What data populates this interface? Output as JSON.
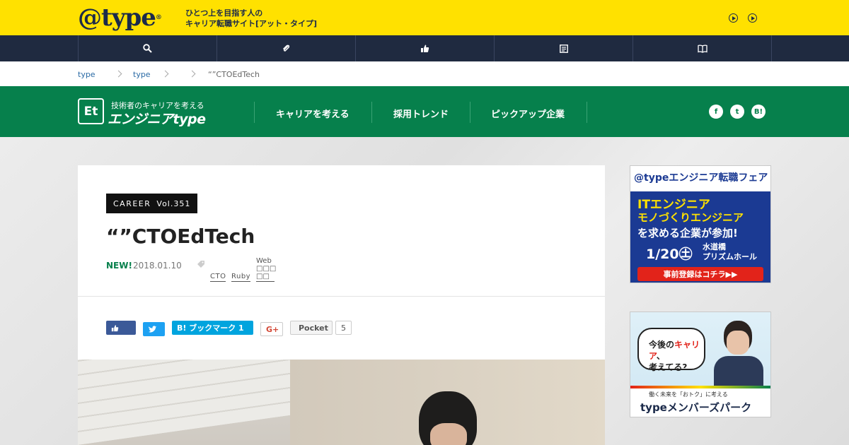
{
  "site": {
    "logo": "@type",
    "tagline_1": "ひとつ上を目指す人の",
    "tagline_2": "キャリア転職サイト[アット・タイプ]"
  },
  "darknav": {
    "items": [
      {
        "icon": "search-icon"
      },
      {
        "icon": "paperclip-icon"
      },
      {
        "icon": "thumbs-up-icon"
      },
      {
        "icon": "list-icon"
      },
      {
        "icon": "book-icon"
      }
    ]
  },
  "breadcrumb": {
    "items": [
      "type",
      "type",
      "",
      "“”CTOEdTech"
    ]
  },
  "header": {
    "brand_sub": "技術者のキャリアを考える",
    "brand_title": "エンジニアtype",
    "brand_mark": "Et",
    "nav": [
      "キャリアを考える",
      "採用トレンド",
      "ピックアップ企業"
    ],
    "social": [
      {
        "icon": "facebook-icon",
        "glyph": "f"
      },
      {
        "icon": "twitter-icon",
        "glyph": "t"
      },
      {
        "icon": "hatena-icon",
        "glyph": "B!"
      }
    ]
  },
  "article": {
    "category": "CAREER",
    "vol": "Vol.351",
    "title": "“”CTOEdTech",
    "new_label": "NEW!",
    "date": "2018.01.10",
    "tags": [
      "CTO",
      "Ruby"
    ],
    "tag_web_1": "Web",
    "tag_web_2": "□□□",
    "tag_web_3": "□□",
    "share": {
      "hatena_label": "B! ブックマーク 1",
      "gplus_label": "G+",
      "pocket_label": "Pocket",
      "pocket_count": "5"
    }
  },
  "ads": {
    "fair": {
      "brand": "@typeエンジニア転職フェア",
      "line_1": "ITエンジニア",
      "line_2": "モノづくりエンジニア",
      "line_3": "を求める企業が参加!",
      "date": "1/20㊏",
      "venue_1": "水道橋",
      "venue_2": "プリズムホール",
      "cta": "事前登録はコチラ▶▶"
    },
    "members": {
      "bubble_1": "今後の",
      "bubble_hl": "キャリア",
      "bubble_2": "、",
      "bubble_3": "考えてる?",
      "small": "働く未来を「おトク」に考える",
      "brand": "typeメンバーズパーク"
    }
  },
  "colors": {
    "yellow": "#ffe100",
    "navy": "#1f2a40",
    "green": "#06804c"
  }
}
